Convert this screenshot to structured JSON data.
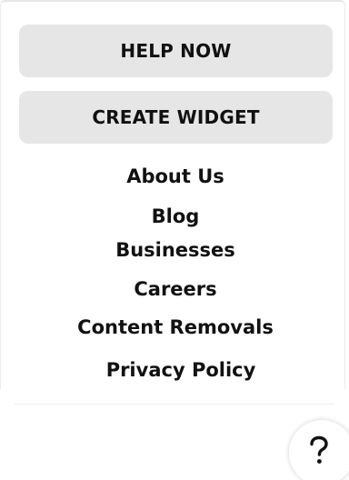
{
  "buttons": {
    "help_now": "HELP NOW",
    "create_widget": "CREATE WIDGET"
  },
  "links": {
    "about_us": "About Us",
    "blog": "Blog",
    "businesses": "Businesses",
    "careers": "Careers",
    "content_removals": "Content Removals",
    "privacy_policy": "Privacy Policy"
  },
  "fab": {
    "icon": "question-mark-icon"
  }
}
